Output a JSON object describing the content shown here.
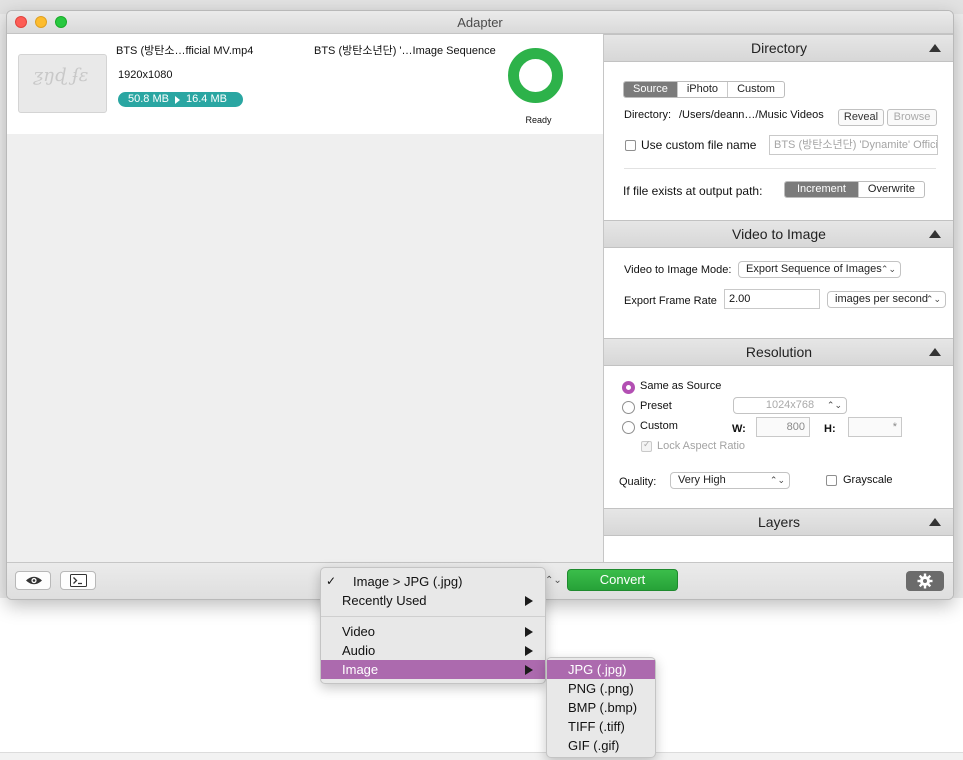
{
  "window": {
    "title": "Adapter"
  },
  "file": {
    "name": "BTS (방탄소…fficial MV.mp4",
    "output_name": "BTS (방탄소년단) '…Image Sequence",
    "resolution": "1920x1080",
    "size_from": "50.8 MB",
    "size_to": "16.4 MB",
    "status": "Ready"
  },
  "directory": {
    "header": "Directory",
    "tabs": [
      "Source",
      "iPhoto",
      "Custom"
    ],
    "selected_tab": "Source",
    "label": "Directory:",
    "path": "/Users/deann…/Music Videos",
    "reveal_label": "Reveal",
    "browse_label": "Browse",
    "custom_name_label": "Use custom file name",
    "custom_name_placeholder": "BTS (방탄소년단) 'Dynamite' Official",
    "exists_label": "If file exists at output path:",
    "exists_options": [
      "Increment",
      "Overwrite"
    ],
    "exists_selected": "Increment"
  },
  "video_to_image": {
    "header": "Video to Image",
    "mode_label": "Video to Image Mode:",
    "mode_value": "Export Sequence of Images",
    "rate_label": "Export Frame Rate",
    "rate_value": "2.00",
    "rate_unit": "images per second"
  },
  "resolution": {
    "header": "Resolution",
    "options": [
      "Same as Source",
      "Preset",
      "Custom"
    ],
    "selected": "Same as Source",
    "preset_value": "1024x768",
    "w_label": "W:",
    "w_value": "800",
    "h_label": "H:",
    "h_value": "*",
    "lock_label": "Lock Aspect Ratio",
    "quality_label": "Quality:",
    "quality_value": "Very High",
    "grayscale_label": "Grayscale"
  },
  "layers": {
    "header": "Layers"
  },
  "toolbar": {
    "convert_label": "Convert",
    "stepper_glyph": "⌃⌄"
  },
  "menu": {
    "items": [
      {
        "label": "Image > JPG (.jpg)",
        "checked": true
      },
      {
        "label": "Recently Used",
        "submenu": true
      },
      {
        "label": "Video",
        "submenu": true
      },
      {
        "label": "Audio",
        "submenu": true
      },
      {
        "label": "Image",
        "submenu": true,
        "highlighted": true
      }
    ]
  },
  "submenu": {
    "items": [
      "JPG (.jpg)",
      "PNG (.png)",
      "BMP (.bmp)",
      "TIFF (.tiff)",
      "GIF (.gif)"
    ],
    "highlighted": "JPG (.jpg)"
  },
  "colors": {
    "accent_purple": "#ac6aae",
    "convert_green": "#2db24a",
    "size_teal": "#2aa6a2",
    "radio_selected": "#b34fb3"
  },
  "icons": [
    "eye-icon",
    "terminal-icon",
    "gear-icon",
    "collapse-triangle-icon",
    "submenu-arrow-icon",
    "checkmark-icon"
  ]
}
